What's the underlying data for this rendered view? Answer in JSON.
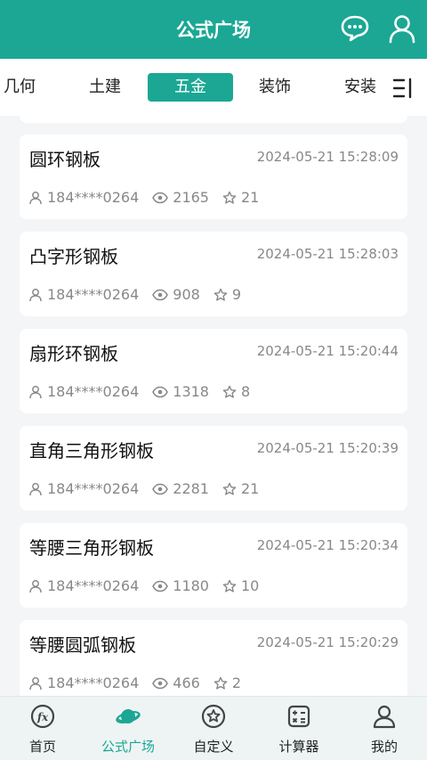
{
  "header": {
    "title": "公式广场",
    "message_icon": "chat-bubble-icon",
    "user_icon": "user-icon"
  },
  "tabs": [
    {
      "label": "几何"
    },
    {
      "label": "土建"
    },
    {
      "label": "五金",
      "active": true
    },
    {
      "label": "装饰"
    },
    {
      "label": "安装"
    }
  ],
  "cards": [
    {
      "title": "圆环钢板",
      "time": "2024-05-21 15:28:09",
      "author": "184****0264",
      "views": "2165",
      "stars": "21"
    },
    {
      "title": "凸字形钢板",
      "time": "2024-05-21 15:28:03",
      "author": "184****0264",
      "views": "908",
      "stars": "9"
    },
    {
      "title": "扇形环钢板",
      "time": "2024-05-21 15:20:44",
      "author": "184****0264",
      "views": "1318",
      "stars": "8"
    },
    {
      "title": "直角三角形钢板",
      "time": "2024-05-21 15:20:39",
      "author": "184****0264",
      "views": "2281",
      "stars": "21"
    },
    {
      "title": "等腰三角形钢板",
      "time": "2024-05-21 15:20:34",
      "author": "184****0264",
      "views": "1180",
      "stars": "10"
    },
    {
      "title": "等腰圆弧钢板",
      "time": "2024-05-21 15:20:29",
      "author": "184****0264",
      "views": "466",
      "stars": "2"
    }
  ],
  "bottom_nav": [
    {
      "label": "首页",
      "icon": "fx-icon"
    },
    {
      "label": "公式广场",
      "icon": "planet-icon",
      "active": true
    },
    {
      "label": "自定义",
      "icon": "star-circle-icon"
    },
    {
      "label": "计算器",
      "icon": "calculator-icon"
    },
    {
      "label": "我的",
      "icon": "user-icon"
    }
  ],
  "colors": {
    "accent": "#1ba794",
    "background": "#f4f5f7",
    "meta_text": "#888888"
  }
}
